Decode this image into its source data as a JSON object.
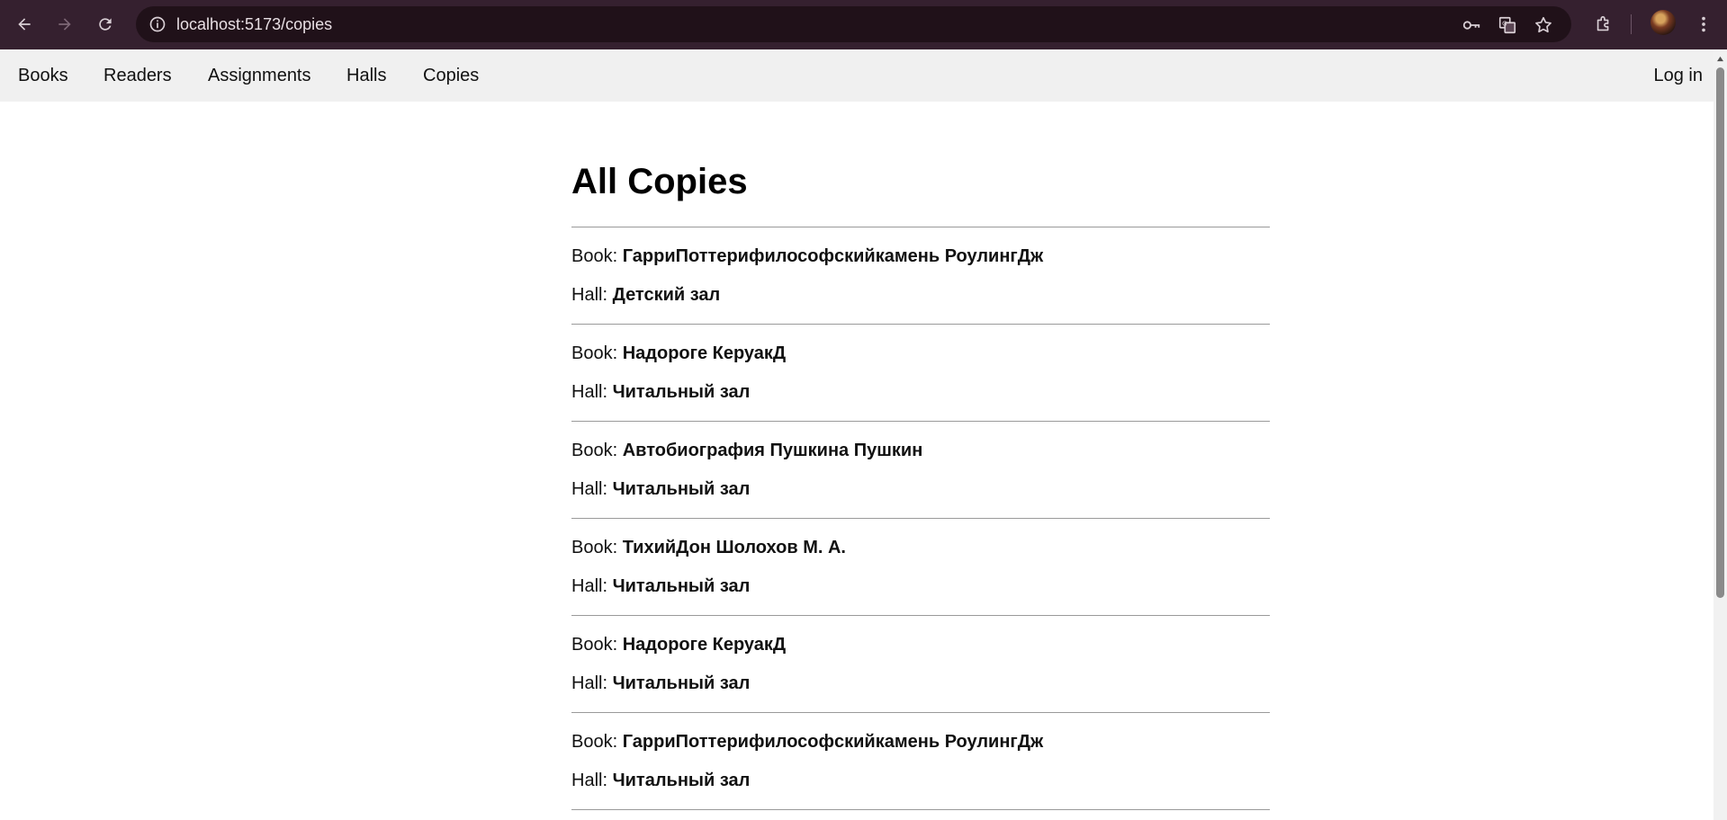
{
  "browser": {
    "url": "localhost:5173/copies",
    "icons": [
      "back-arrow-icon",
      "forward-arrow-icon",
      "reload-icon",
      "site-info-icon",
      "key-icon",
      "translate-icon",
      "star-icon",
      "extensions-icon",
      "profile-avatar",
      "kebab-menu-icon"
    ]
  },
  "nav": {
    "links": [
      "Books",
      "Readers",
      "Assignments",
      "Halls",
      "Copies"
    ],
    "login": "Log in"
  },
  "page": {
    "title": "All Copies",
    "book_label": "Book:",
    "hall_label": "Hall:"
  },
  "copies": [
    {
      "book": "ГарриПоттерифилософскийкамень РоулингДж",
      "hall": "Детский зал"
    },
    {
      "book": "Надороге КеруакД",
      "hall": "Читальный зал"
    },
    {
      "book": "Автобиография Пушкина Пушкин",
      "hall": "Читальный зал"
    },
    {
      "book": "ТихийДон Шолохов М. А.",
      "hall": "Читальный зал"
    },
    {
      "book": "Надороге КеруакД",
      "hall": "Читальный зал"
    },
    {
      "book": "ГарриПоттерифилософскийкамень РоулингДж",
      "hall": "Читальный зал"
    }
  ],
  "colors": {
    "browser_bar": "#35202f",
    "omnibox": "#201119",
    "app_nav": "#f0f0f0",
    "divider": "#9a9a9a"
  }
}
